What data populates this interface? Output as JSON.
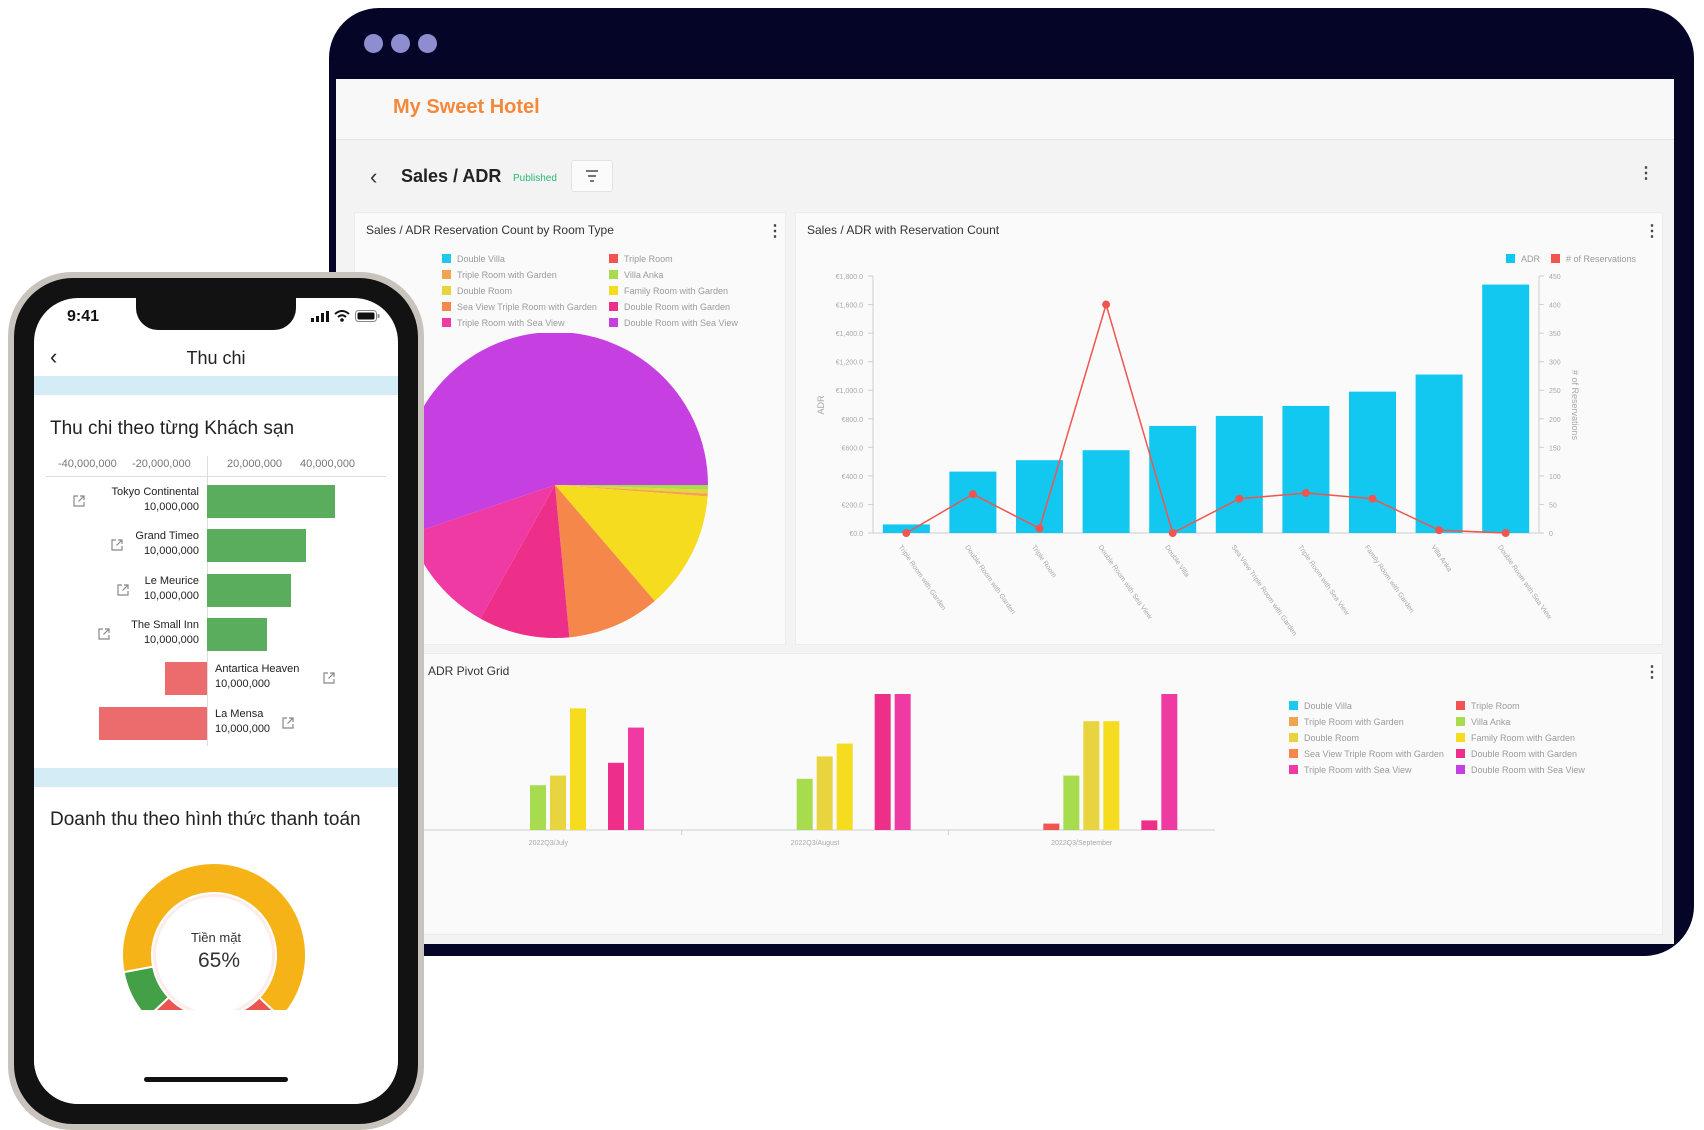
{
  "tablet": {
    "app_title": "My Sweet Hotel",
    "dashboard": {
      "title": "Sales / ADR",
      "status_badge": "Published"
    },
    "pie_card": {
      "title": "Sales / ADR Reservation Count by Room Type",
      "legend": [
        {
          "label": "Double Villa",
          "color": "#1ec9f0"
        },
        {
          "label": "Triple Room",
          "color": "#f0554f"
        },
        {
          "label": "Triple Room with Garden",
          "color": "#f0a450"
        },
        {
          "label": "Villa Anka",
          "color": "#a8dc4f"
        },
        {
          "label": "Double Room",
          "color": "#e8d43e"
        },
        {
          "label": "Family Room with Garden",
          "color": "#f5dc1e"
        },
        {
          "label": "Sea View Triple Room with Garden",
          "color": "#f5874a"
        },
        {
          "label": "Double Room with Garden",
          "color": "#ee2f8a"
        },
        {
          "label": "Triple Room with Sea View",
          "color": "#ef3aa4"
        },
        {
          "label": "Double Room with Sea View",
          "color": "#c63fe0"
        }
      ]
    },
    "combo_card": {
      "title": "Sales / ADR with Reservation Count",
      "legend": [
        {
          "label": "ADR",
          "color": "#12c8f1"
        },
        {
          "label": "# of Reservations",
          "color": "#f0554f"
        }
      ],
      "y_left_label": "ADR",
      "y_right_label": "# of Reservations",
      "y_left_ticks": [
        "€1,800.0",
        "€1,600.0",
        "€1,400.0",
        "€1,200.0",
        "€1,000.0",
        "€800.0",
        "€600.0",
        "€400.0",
        "€200.0",
        "€0.0"
      ],
      "y_right_ticks": [
        "450",
        "400",
        "350",
        "300",
        "250",
        "200",
        "150",
        "100",
        "50",
        "0"
      ]
    },
    "pivot_card": {
      "title": "ADR Pivot Grid",
      "x_labels": [
        "2022Q3/July",
        "2022Q3/August",
        "2022Q3/September"
      ],
      "legend": [
        {
          "label": "Double Villa",
          "color": "#1ec9f0"
        },
        {
          "label": "Triple Room",
          "color": "#f0554f"
        },
        {
          "label": "Triple Room with Garden",
          "color": "#f0a450"
        },
        {
          "label": "Villa Anka",
          "color": "#a8dc4f"
        },
        {
          "label": "Double Room",
          "color": "#e8d43e"
        },
        {
          "label": "Family Room with Garden",
          "color": "#f5dc1e"
        },
        {
          "label": "Sea View Triple Room with Garden",
          "color": "#f5874a"
        },
        {
          "label": "Double Room with Garden",
          "color": "#ee2f8a"
        },
        {
          "label": "Triple Room with Sea View",
          "color": "#ef3aa4"
        },
        {
          "label": "Double Room with Sea View",
          "color": "#c63fe0"
        }
      ]
    }
  },
  "phone": {
    "status_time": "9:41",
    "nav_title": "Thu chi",
    "section1_title": "Thu chi theo từng Khách sạn",
    "axis_ticks": [
      "-40,000,000",
      "-20,000,000",
      "20,000,000",
      "40,000,000"
    ],
    "rows": [
      {
        "name": "Tokyo Continental",
        "value": "10,000,000"
      },
      {
        "name": "Grand Timeo",
        "value": "10,000,000"
      },
      {
        "name": "Le Meurice",
        "value": "10,000,000"
      },
      {
        "name": "The Small Inn",
        "value": "10,000,000"
      },
      {
        "name": "Antartica Heaven",
        "value": "10,000,000"
      },
      {
        "name": "La Mensa",
        "value": "10,000,000"
      }
    ],
    "section2_title": "Doanh thu theo hình thức thanh toán",
    "donut_label": "Tiền mặt",
    "donut_value": "65%"
  },
  "chart_data": [
    {
      "type": "pie",
      "title": "Sales / ADR Reservation Count by Room Type",
      "slices": [
        {
          "label": "Double Room with Sea View",
          "value": 55.2,
          "color": "#c63fe0"
        },
        {
          "label": "Villa Anka",
          "value": 0.5,
          "color": "#a8dc4f"
        },
        {
          "label": "Double Room",
          "value": 0.4,
          "color": "#e8d43e"
        },
        {
          "label": "Triple Room with Garden",
          "value": 0.3,
          "color": "#f0a450"
        },
        {
          "label": "Family Room with Garden",
          "value": 12.5,
          "color": "#f5dc1e"
        },
        {
          "label": "Sea View Triple Room with Garden",
          "value": 9.8,
          "color": "#f5874a"
        },
        {
          "label": "Double Room with Garden",
          "value": 9.6,
          "color": "#ee2f8a"
        },
        {
          "label": "Triple Room with Sea View",
          "value": 11.7,
          "color": "#ef3aa4"
        }
      ]
    },
    {
      "type": "bar",
      "title": "Sales / ADR with Reservation Count",
      "categories": [
        "Triple Room with Garden",
        "Double Room with Garden",
        "Triple Room",
        "Double Room with Sea View",
        "Double Villa",
        "Sea View Triple Room with Garden",
        "Triple Room with Sea View",
        "Family Room with Garden",
        "Villa Anka",
        "Double Room with Sea View"
      ],
      "series": [
        {
          "name": "ADR",
          "type": "bar",
          "axis": "left",
          "values": [
            60,
            430,
            510,
            580,
            750,
            820,
            890,
            990,
            1110,
            1740
          ]
        },
        {
          "name": "# of Reservations",
          "type": "line",
          "axis": "right",
          "values": [
            0,
            68,
            8,
            400,
            0,
            60,
            70,
            60,
            5,
            0
          ]
        }
      ],
      "ylim_left": [
        0,
        1800
      ],
      "ylim_right": [
        0,
        450
      ],
      "ylabel_left": "ADR",
      "ylabel_right": "# of Reservations"
    },
    {
      "type": "bar",
      "title": "ADR Pivot Grid",
      "categories": [
        "2022Q3/July",
        "2022Q3/August",
        "2022Q3/September"
      ],
      "ylim": [
        0,
        4
      ],
      "series": [
        {
          "name": "Triple Room",
          "color": "#f0554f",
          "values": [
            0,
            0,
            0.2
          ]
        },
        {
          "name": "Villa Anka",
          "color": "#a8dc4f",
          "values": [
            1.4,
            1.6,
            1.7
          ]
        },
        {
          "name": "Double Room",
          "color": "#e8d43e",
          "values": [
            1.7,
            2.3,
            3.4
          ]
        },
        {
          "name": "Family Room with Garden",
          "color": "#f5dc1e",
          "values": [
            3.8,
            2.7,
            3.4
          ]
        },
        {
          "name": "Double Room with Garden",
          "color": "#ee2f8a",
          "values": [
            2.1,
            4.3,
            0.3
          ]
        },
        {
          "name": "Triple Room with Sea View",
          "color": "#ef3aa4",
          "values": [
            3.2,
            4.5,
            4.3
          ]
        }
      ]
    },
    {
      "type": "bar",
      "title": "Thu chi theo từng Khách sạn",
      "categories": [
        "Tokyo Continental",
        "Grand Timeo",
        "Le Meurice",
        "The Small Inn",
        "Antartica Heaven",
        "La Mensa"
      ],
      "values": [
        35000000,
        27000000,
        23000000,
        16500000,
        -11500000,
        -29500000
      ],
      "xlim": [
        -50000000,
        50000000
      ]
    },
    {
      "type": "pie",
      "title": "Doanh thu theo hình thức thanh toán",
      "slices": [
        {
          "label": "Tiền mặt",
          "value": 65,
          "color": "#f6b317"
        },
        {
          "label": "",
          "value": 26,
          "color": "#ec5452"
        },
        {
          "label": "",
          "value": 9,
          "color": "#43a047"
        }
      ]
    }
  ]
}
